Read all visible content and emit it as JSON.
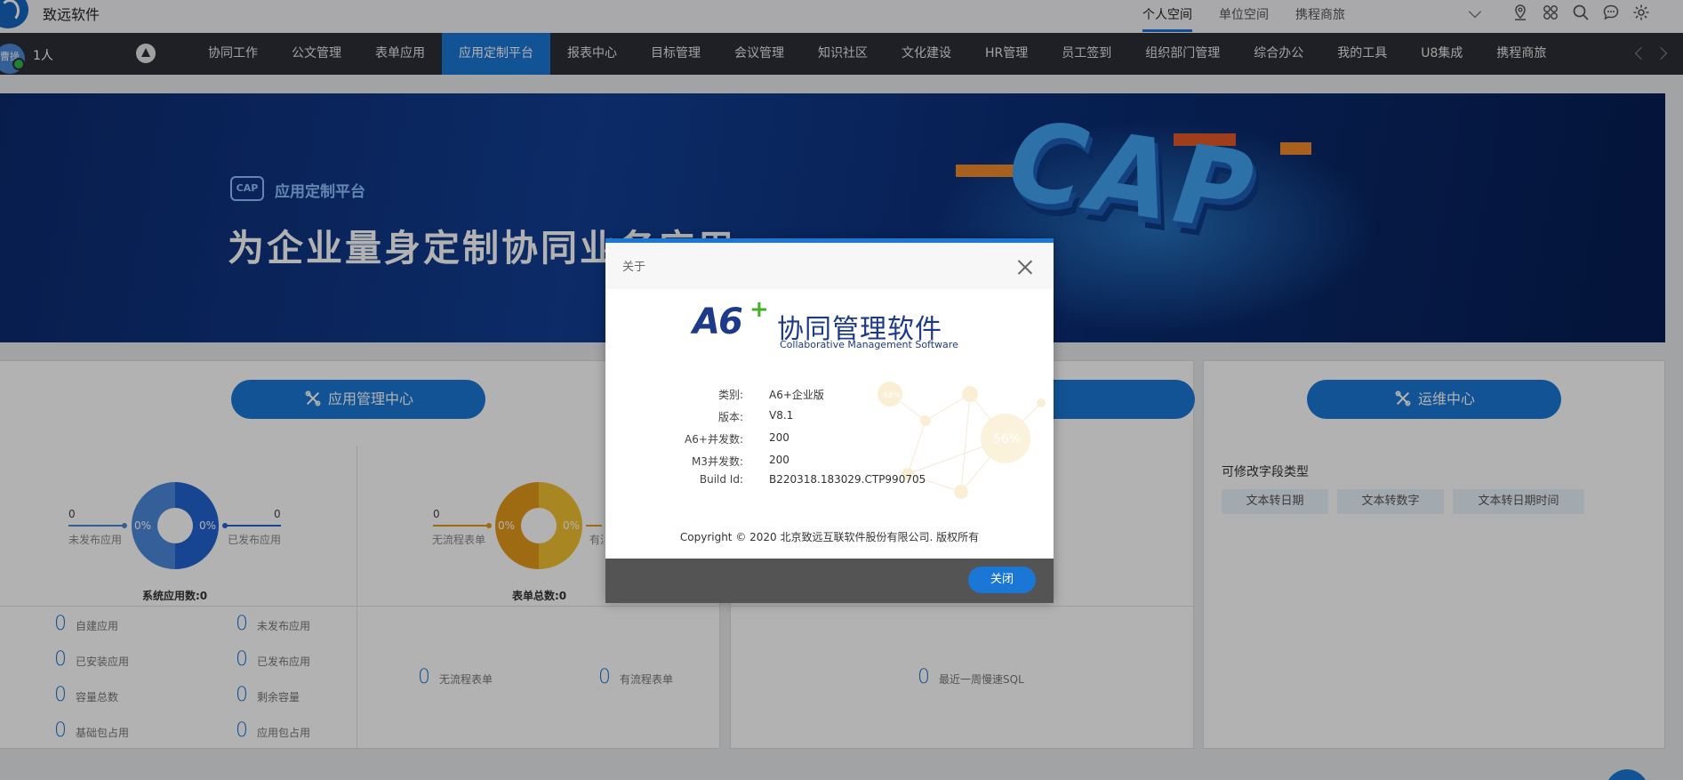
{
  "app": {
    "title": "致远软件"
  },
  "spaces": [
    "个人空间",
    "单位空间",
    "携程商旅"
  ],
  "user": {
    "avatar_text": "曹操",
    "online": "1人"
  },
  "nav": {
    "items": [
      "协同工作",
      "公文管理",
      "表单应用",
      "应用定制平台",
      "报表中心",
      "目标管理",
      "会议管理",
      "知识社区",
      "文化建设",
      "HR管理",
      "员工签到",
      "组织部门管理",
      "综合办公",
      "我的工具",
      "U8集成",
      "携程商旅"
    ],
    "active_index": 3
  },
  "banner": {
    "badge": "CAP",
    "subtitle": "应用定制平台",
    "title": "为企业量身定制协同业务应用",
    "graphic_text": "CAP"
  },
  "panel1": {
    "button": "应用管理中心",
    "chart1": {
      "left_value": "0",
      "left_label": "未发布应用",
      "right_value": "0",
      "right_label": "已发布应用",
      "pct_left": "0%",
      "pct_right": "0%",
      "caption": "系统应用数:0"
    },
    "chart2": {
      "left_value": "0",
      "left_label": "无流程表单",
      "right_label": "有流程表单",
      "pct_left": "0%",
      "pct_right": "0%",
      "caption": "表单总数:0"
    },
    "stats": [
      {
        "value": "0",
        "label": "自建应用"
      },
      {
        "value": "0",
        "label": "未发布应用"
      },
      {
        "value": "0",
        "label": "已安装应用"
      },
      {
        "value": "0",
        "label": "已发布应用"
      },
      {
        "value": "0",
        "label": "容量总数"
      },
      {
        "value": "0",
        "label": "剩余容量"
      },
      {
        "value": "0",
        "label": "基础包占用"
      },
      {
        "value": "0",
        "label": "应用包占用"
      }
    ],
    "form_stats": [
      {
        "value": "0",
        "label": "无流程表单"
      },
      {
        "value": "0",
        "label": "有流程表单"
      }
    ]
  },
  "panel2": {
    "stat": {
      "value": "0",
      "label": "最近一周慢速SQL"
    }
  },
  "panel3": {
    "button": "运维中心",
    "section_label": "可修改字段类型",
    "chips": [
      "文本转日期",
      "文本转数字",
      "文本转日期时间"
    ]
  },
  "modal": {
    "title": "关于",
    "brand_a6": "A6",
    "brand_plus": "+",
    "brand_name": "协同管理软件",
    "brand_en": "Collaborative Management Software",
    "info": [
      {
        "key": "类别:",
        "value": "A6+企业版"
      },
      {
        "key": "版本:",
        "value": "V8.1"
      },
      {
        "key": "A6+并发数:",
        "value": "200"
      },
      {
        "key": "M3并发数:",
        "value": "200"
      },
      {
        "key": "Build Id:",
        "value": "B220318.183029.CTP990705"
      }
    ],
    "watermark": {
      "pct_small": "48%",
      "pct_big": "56%"
    },
    "copyright": "Copyright © 2020 北京致远互联软件股份有限公司. 版权所有",
    "close_button": "关闭"
  },
  "colors": {
    "accent": "#1b77d6",
    "nav_bg": "#2d2f35",
    "donut_blue": "#2163d1",
    "donut_orange": "#e39a1b"
  }
}
